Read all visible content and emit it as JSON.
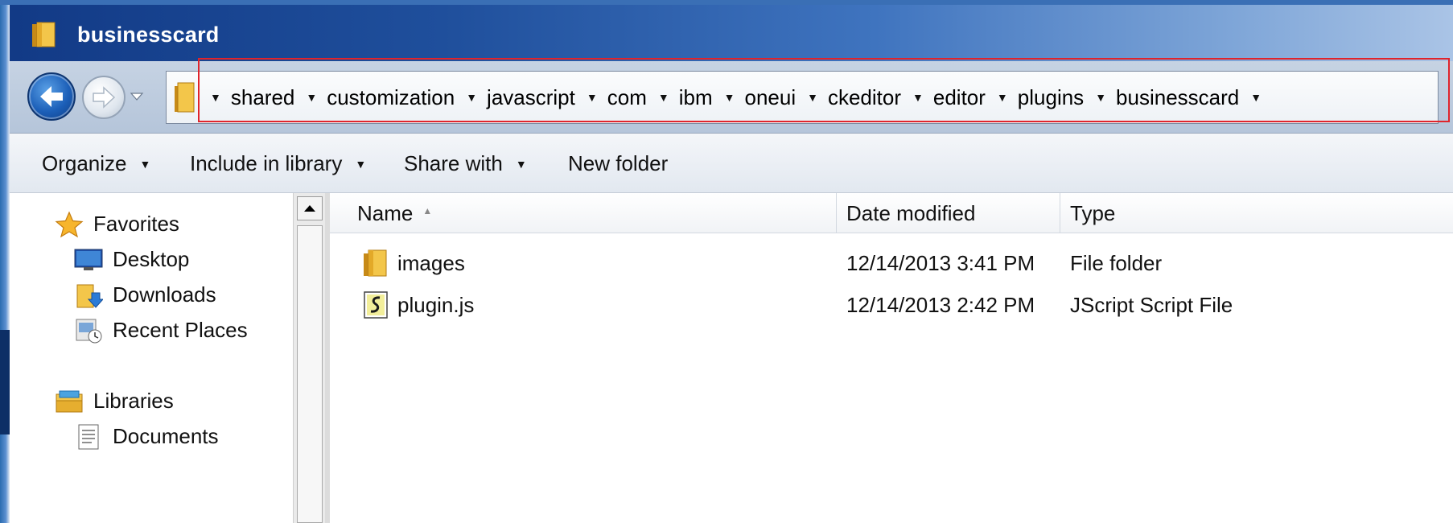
{
  "window": {
    "title": "businesscard"
  },
  "address": {
    "crumbs": [
      "shared",
      "customization",
      "javascript",
      "com",
      "ibm",
      "oneui",
      "ckeditor",
      "editor",
      "plugins",
      "businesscard"
    ]
  },
  "toolbar": {
    "organize": "Organize",
    "include_in_library": "Include in library",
    "share_with": "Share with",
    "new_folder": "New folder"
  },
  "nav": {
    "favorites": "Favorites",
    "desktop": "Desktop",
    "downloads": "Downloads",
    "recent_places": "Recent Places",
    "libraries": "Libraries",
    "documents": "Documents"
  },
  "columns": {
    "name": "Name",
    "date_modified": "Date modified",
    "type": "Type"
  },
  "files": [
    {
      "name": "images",
      "date": "12/14/2013 3:41 PM",
      "type": "File folder",
      "icon": "folder-icon"
    },
    {
      "name": "plugin.js",
      "date": "12/14/2013 2:42 PM",
      "type": "JScript Script File",
      "icon": "script-file-icon"
    }
  ],
  "colors": {
    "title_bar": "#1f4f9c",
    "highlight_box": "#e0242b"
  }
}
